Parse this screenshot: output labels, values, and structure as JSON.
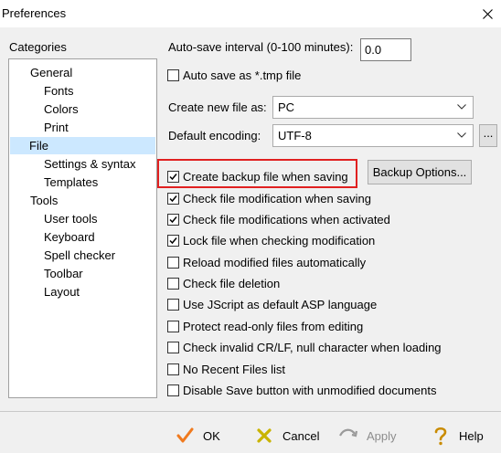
{
  "window": {
    "title": "Preferences"
  },
  "categories": {
    "label": "Categories",
    "items": [
      {
        "label": "General",
        "level": 1
      },
      {
        "label": "Fonts",
        "level": 2
      },
      {
        "label": "Colors",
        "level": 2
      },
      {
        "label": "Print",
        "level": 2
      },
      {
        "label": "File",
        "level": 1,
        "selected": true
      },
      {
        "label": "Settings & syntax",
        "level": 2
      },
      {
        "label": "Templates",
        "level": 2
      },
      {
        "label": "Tools",
        "level": 1
      },
      {
        "label": "User tools",
        "level": 2
      },
      {
        "label": "Keyboard",
        "level": 2
      },
      {
        "label": "Spell checker",
        "level": 2
      },
      {
        "label": "Toolbar",
        "level": 2
      },
      {
        "label": "Layout",
        "level": 2
      }
    ]
  },
  "file": {
    "autosave_label": "Auto-save interval (0-100 minutes):",
    "autosave_value": "0.0",
    "autosave_tmp_label": "Auto save as *.tmp file",
    "create_new_label": "Create new file as:",
    "create_new_value": "PC",
    "encoding_label": "Default encoding:",
    "encoding_value": "UTF-8",
    "encoding_more_label": "...",
    "backup_options_label": "Backup Options...",
    "checkboxes": [
      {
        "label": "Create backup file when saving",
        "checked": true
      },
      {
        "label": "Check file modification when saving",
        "checked": true
      },
      {
        "label": "Check file modifications when activated",
        "checked": true
      },
      {
        "label": "Lock file when checking modification",
        "checked": true
      },
      {
        "label": "Reload modified files automatically",
        "checked": false
      },
      {
        "label": "Check file deletion",
        "checked": false
      },
      {
        "label": "Use JScript as default ASP language",
        "checked": false
      },
      {
        "label": "Protect read-only files from editing",
        "checked": false
      },
      {
        "label": "Check invalid CR/LF, null character when loading",
        "checked": false
      },
      {
        "label": "No Recent Files list",
        "checked": false
      },
      {
        "label": "Disable Save button with unmodified documents",
        "checked": false
      }
    ]
  },
  "footer": {
    "ok_label": "OK",
    "cancel_label": "Cancel",
    "apply_label": "Apply",
    "help_label": "Help"
  },
  "icons": {
    "ok": "checkmark-icon",
    "cancel": "cross-icon",
    "apply": "apply-icon",
    "help": "help-icon"
  },
  "colors": {
    "ok_icon": "#f07a1e",
    "cancel_icon": "#c9b400",
    "highlight": "#e02020",
    "selected_row": "#cce8ff"
  }
}
